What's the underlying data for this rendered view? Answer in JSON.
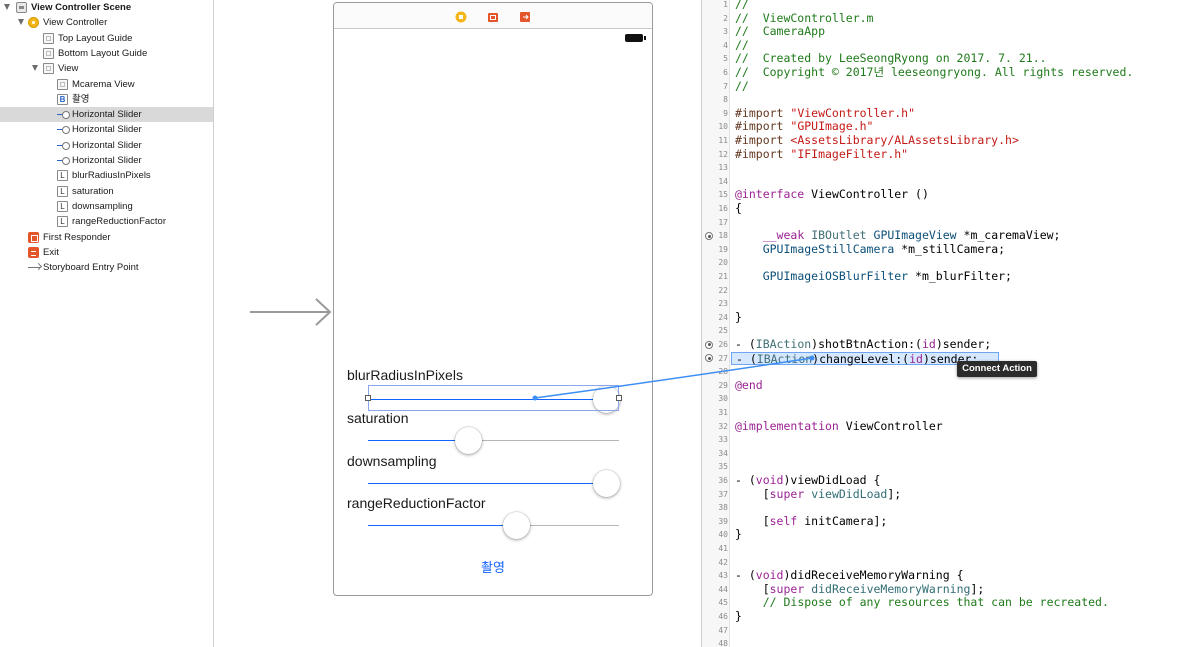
{
  "outline": {
    "items": [
      {
        "label": "View Controller Scene",
        "icon": "scene-icon"
      },
      {
        "label": "View Controller",
        "icon": "view-controller-icon"
      },
      {
        "label": "Top Layout Guide",
        "icon": "layout-guide-icon"
      },
      {
        "label": "Bottom Layout Guide",
        "icon": "layout-guide-icon"
      },
      {
        "label": "View",
        "icon": "view-icon"
      },
      {
        "label": "Mcarema View",
        "icon": "view-icon"
      },
      {
        "label": "촬영",
        "icon": "button-icon"
      },
      {
        "label": "Horizontal Slider",
        "icon": "slider-icon"
      },
      {
        "label": "Horizontal Slider",
        "icon": "slider-icon"
      },
      {
        "label": "Horizontal Slider",
        "icon": "slider-icon"
      },
      {
        "label": "Horizontal Slider",
        "icon": "slider-icon"
      },
      {
        "label": "blurRadiusInPixels",
        "icon": "label-icon"
      },
      {
        "label": "saturation",
        "icon": "label-icon"
      },
      {
        "label": "downsampling",
        "icon": "label-icon"
      },
      {
        "label": "rangeReductionFactor",
        "icon": "label-icon"
      },
      {
        "label": "First Responder",
        "icon": "first-responder-icon"
      },
      {
        "label": "Exit",
        "icon": "exit-icon"
      },
      {
        "label": "Storyboard Entry Point",
        "icon": "arrow-icon"
      }
    ],
    "button_glyph": "B",
    "label_glyph": "L"
  },
  "scene": {
    "sliders": [
      {
        "label": "blurRadiusInPixels",
        "value": 0.95
      },
      {
        "label": "saturation",
        "value": 0.4
      },
      {
        "label": "downsampling",
        "value": 0.95
      },
      {
        "label": "rangeReductionFactor",
        "value": 0.59
      }
    ],
    "button_label": "촬영"
  },
  "editor": {
    "lines": [
      [
        [
          "com",
          "//"
        ]
      ],
      [
        [
          "com",
          "//  ViewController.m"
        ]
      ],
      [
        [
          "com",
          "//  CameraApp"
        ]
      ],
      [
        [
          "com",
          "//"
        ]
      ],
      [
        [
          "com",
          "//  Created by LeeSeongRyong on 2017. 7. 21.."
        ]
      ],
      [
        [
          "com",
          "//  Copyright © 2017년 leeseongryong. All rights reserved."
        ]
      ],
      [
        [
          "com",
          "//"
        ]
      ],
      [],
      [
        [
          "pre",
          "#import "
        ],
        [
          "str",
          "\"ViewController.h\""
        ]
      ],
      [
        [
          "pre",
          "#import "
        ],
        [
          "str",
          "\"GPUImage.h\""
        ]
      ],
      [
        [
          "pre",
          "#import "
        ],
        [
          "str",
          "<AssetsLibrary/ALAssetsLibrary.h>"
        ]
      ],
      [
        [
          "pre",
          "#import "
        ],
        [
          "str",
          "\"IFImageFilter.h\""
        ]
      ],
      [],
      [],
      [
        [
          "kw",
          "@interface"
        ],
        [
          "plain",
          " ViewController ()"
        ]
      ],
      [
        [
          "plain",
          "{"
        ]
      ],
      [],
      [
        [
          "plain",
          "    "
        ],
        [
          "kw",
          "__weak"
        ],
        [
          "plain",
          " "
        ],
        [
          "type",
          "IBOutlet"
        ],
        [
          "plain",
          " "
        ],
        [
          "cls",
          "GPUImageView"
        ],
        [
          "plain",
          " *m_caremaView;"
        ]
      ],
      [
        [
          "plain",
          "    "
        ],
        [
          "cls",
          "GPUImageStillCamera"
        ],
        [
          "plain",
          " *m_stillCamera;"
        ]
      ],
      [],
      [
        [
          "plain",
          "    "
        ],
        [
          "cls",
          "GPUImageiOSBlurFilter"
        ],
        [
          "plain",
          " *m_blurFilter;"
        ]
      ],
      [],
      [],
      [
        [
          "plain",
          "}"
        ]
      ],
      [],
      [
        [
          "plain",
          "- ("
        ],
        [
          "type",
          "IBAction"
        ],
        [
          "plain",
          ")shotBtnAction:("
        ],
        [
          "kw",
          "id"
        ],
        [
          "plain",
          ")sender;"
        ]
      ],
      [
        [
          "plain",
          "- ("
        ],
        [
          "type",
          "IBAction"
        ],
        [
          "plain",
          ")changeLevel:("
        ],
        [
          "kw",
          "id"
        ],
        [
          "plain",
          ")sender;"
        ]
      ],
      [],
      [
        [
          "kw",
          "@end"
        ]
      ],
      [],
      [],
      [
        [
          "kw",
          "@implementation"
        ],
        [
          "plain",
          " ViewController"
        ]
      ],
      [],
      [],
      [],
      [
        [
          "plain",
          "- ("
        ],
        [
          "kw",
          "void"
        ],
        [
          "plain",
          ")viewDidLoad {"
        ]
      ],
      [
        [
          "plain",
          "    ["
        ],
        [
          "kw",
          "super"
        ],
        [
          "plain",
          " "
        ],
        [
          "meth",
          "viewDidLoad"
        ],
        [
          "plain",
          "];"
        ]
      ],
      [],
      [
        [
          "plain",
          "    ["
        ],
        [
          "kw",
          "self"
        ],
        [
          "plain",
          " initCamera];"
        ]
      ],
      [
        [
          "plain",
          "}"
        ]
      ],
      [],
      [],
      [
        [
          "plain",
          "- ("
        ],
        [
          "kw",
          "void"
        ],
        [
          "plain",
          ")didReceiveMemoryWarning {"
        ]
      ],
      [
        [
          "plain",
          "    ["
        ],
        [
          "kw",
          "super"
        ],
        [
          "plain",
          " "
        ],
        [
          "meth",
          "didReceiveMemoryWarning"
        ],
        [
          "plain",
          "];"
        ]
      ],
      [
        [
          "plain",
          "    "
        ],
        [
          "com",
          "// Dispose of any resources that can be recreated."
        ]
      ],
      [
        [
          "plain",
          "}"
        ]
      ],
      [],
      []
    ],
    "breakpoint_lines": [
      18,
      26,
      27
    ],
    "highlight_line": 27,
    "tooltip": "Connect Action"
  },
  "colors": {
    "accent": "#1463ff",
    "selection": "#d9d9d9",
    "connect_line": "#3d8ef5"
  }
}
